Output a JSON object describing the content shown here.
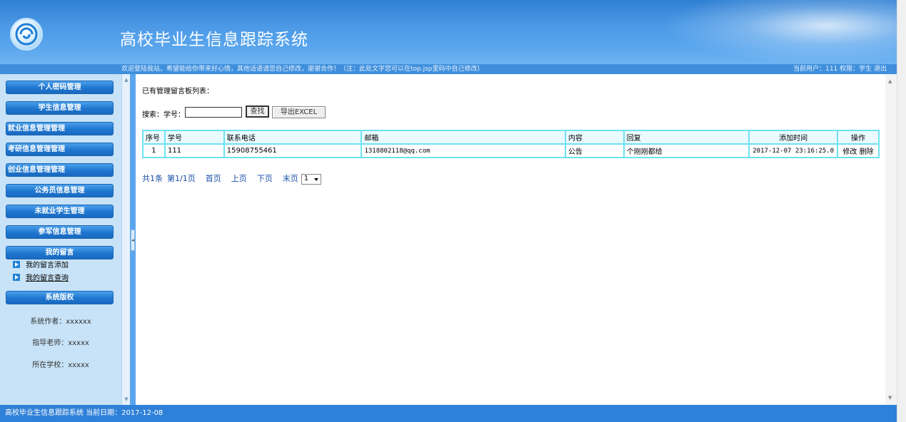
{
  "header": {
    "title": "高校毕业生信息跟踪系统"
  },
  "welcome": {
    "message": "欢迎登陆我站，希望能给你带来好心情，其他话语请您自己修改，谢谢合作！（注：此处文字您可以在top.jsp里码中自己修改）",
    "user_info": "当前用户：111 权限：学生 退出"
  },
  "sidebar": {
    "menus": [
      {
        "label": "个人密码管理"
      },
      {
        "label": "学生信息管理"
      },
      {
        "label": "就业信息管理管理"
      },
      {
        "label": "考研信息管理管理"
      },
      {
        "label": "创业信息管理管理"
      },
      {
        "label": "公务员信息管理"
      },
      {
        "label": "未就业学生管理"
      },
      {
        "label": "参军信息管理"
      },
      {
        "label": "我的留言"
      }
    ],
    "sub_items": [
      {
        "label": "我的留言添加"
      },
      {
        "label": "我的留言查询"
      }
    ],
    "copyright_title": "系统版权",
    "author": "系统作者：xxxxxx",
    "teacher": "指导老师：xxxxx",
    "school": "所在学校：xxxxx"
  },
  "main": {
    "heading": "已有管理留言板列表：",
    "search_label": "搜索：学号：",
    "search_value": "",
    "find_button": "查找",
    "export_button": "导出EXCEL",
    "table": {
      "headers": [
        "序号",
        "学号",
        "联系电话",
        "邮箱",
        "内容",
        "回复",
        "添加时间",
        "操作"
      ],
      "rows": [
        {
          "index": "1",
          "student_no": "111",
          "phone": "15908755461",
          "email": "1318802118@qq.com",
          "content": "公告",
          "reply": "个刚刚都给",
          "time": "2017-12-07 23:16:25.0",
          "edit": "修改",
          "delete": "删除"
        }
      ]
    },
    "pager": {
      "total": "共1条",
      "page": "第1/1页",
      "first": "首页",
      "prev": "上页",
      "next": "下页",
      "last": "末页",
      "selected": "1"
    }
  },
  "footer": {
    "text": "高校毕业生信息跟踪系统 当前日期：2017-12-08"
  },
  "colors": {
    "header_blue": "#4b99e6",
    "sidebar_bg": "#c8e3f7",
    "menu_blue": "#1f76cf",
    "table_border": "#6ee2f2",
    "footer_blue": "#2f80d8"
  }
}
